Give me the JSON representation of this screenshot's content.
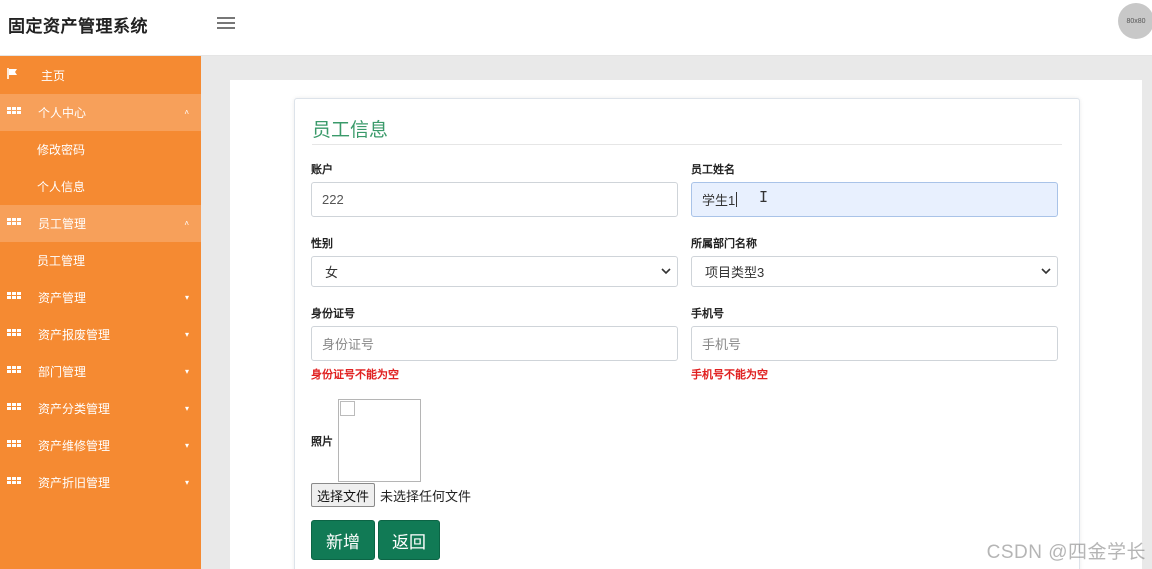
{
  "app": {
    "title": "固定资产管理系统",
    "avatar_text": "80x80"
  },
  "sidebar": {
    "items": [
      {
        "label": "主页",
        "icon": "flag-icon"
      },
      {
        "label": "个人中心",
        "icon": "grid-icon",
        "expanded": true,
        "children": [
          {
            "label": "修改密码"
          },
          {
            "label": "个人信息"
          }
        ]
      },
      {
        "label": "员工管理",
        "icon": "grid-icon",
        "expanded": true,
        "children": [
          {
            "label": "员工管理"
          }
        ]
      },
      {
        "label": "资产管理",
        "icon": "grid-icon"
      },
      {
        "label": "资产报废管理",
        "icon": "grid-icon"
      },
      {
        "label": "部门管理",
        "icon": "grid-icon"
      },
      {
        "label": "资产分类管理",
        "icon": "grid-icon"
      },
      {
        "label": "资产维修管理",
        "icon": "grid-icon"
      },
      {
        "label": "资产折旧管理",
        "icon": "grid-icon"
      }
    ],
    "caret_up": "˄",
    "caret_down": "▾"
  },
  "form": {
    "title": "员工信息",
    "account": {
      "label": "账户",
      "value": "222"
    },
    "name": {
      "label": "员工姓名",
      "value": "学生1"
    },
    "gender": {
      "label": "性别",
      "value": "女"
    },
    "department": {
      "label": "所属部门名称",
      "value": "项目类型3"
    },
    "id_number": {
      "label": "身份证号",
      "placeholder": "身份证号",
      "error": "身份证号不能为空"
    },
    "phone": {
      "label": "手机号",
      "placeholder": "手机号",
      "error": "手机号不能为空"
    },
    "photo": {
      "label": "照片",
      "choose_file": "选择文件",
      "file_status": "未选择任何文件"
    },
    "buttons": {
      "add": "新增",
      "back": "返回"
    }
  },
  "watermark": "CSDN @四金学长",
  "colors": {
    "sidebar": "#f58a32",
    "sidebar_active": "#f7a05a",
    "title_green": "#3a9a6a",
    "button": "#117a55",
    "error": "#e02020"
  }
}
